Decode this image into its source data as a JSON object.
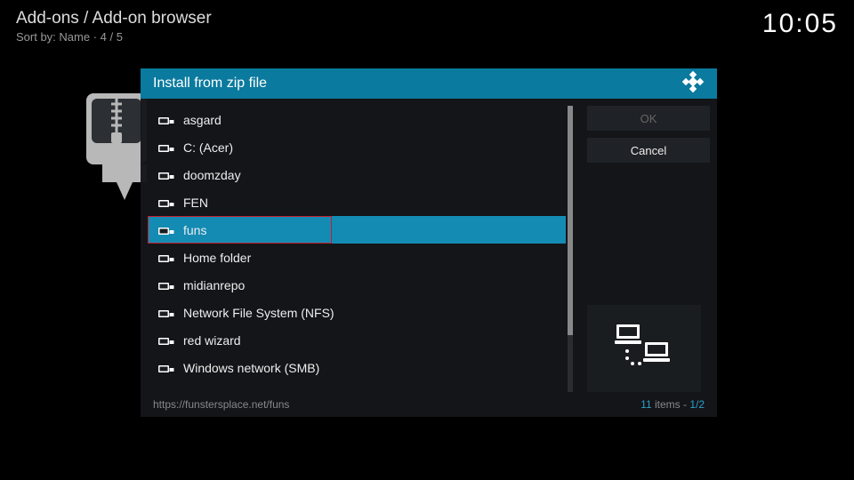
{
  "header": {
    "breadcrumb": "Add-ons / Add-on browser",
    "sortby": "Sort by: Name  ·  4 / 5",
    "clock": "10:05"
  },
  "dialog": {
    "title": "Install from zip file",
    "items": [
      {
        "label": "asgard"
      },
      {
        "label": "C: (Acer)"
      },
      {
        "label": "doomzday"
      },
      {
        "label": "FEN"
      },
      {
        "label": "funs",
        "selected": true,
        "boxed": true
      },
      {
        "label": "Home folder"
      },
      {
        "label": "midianrepo"
      },
      {
        "label": "Network File System (NFS)"
      },
      {
        "label": "red wizard"
      },
      {
        "label": "Windows network (SMB)"
      }
    ],
    "ok_label": "OK",
    "cancel_label": "Cancel",
    "footer_path": "https://funstersplace.net/funs",
    "footer_count": "11",
    "footer_items_word": " items - ",
    "footer_page": "1/2"
  }
}
